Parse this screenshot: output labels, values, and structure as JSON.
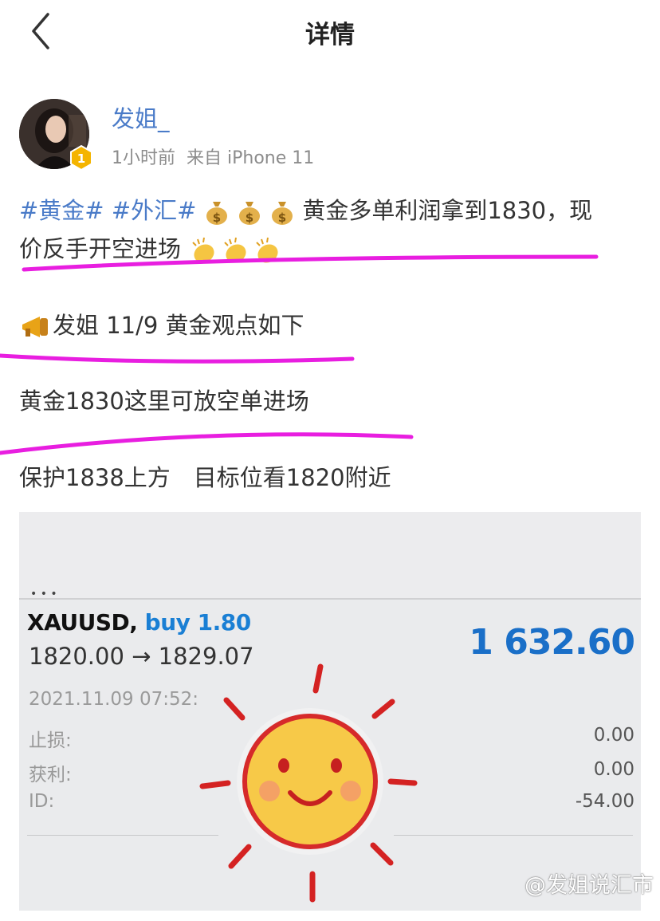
{
  "header": {
    "title": "详情",
    "back_icon": "chevron-left-icon"
  },
  "user": {
    "name": "发姐_",
    "time": "1小时前",
    "source": "来自 iPhone 11",
    "badge_level": "1"
  },
  "post": {
    "tags": [
      "#黄金#",
      "#外汇#"
    ],
    "line1_text": "黄金多单利润拿到1830，现",
    "line2_text": "价反手开空进场",
    "line3_text": "发姐 11/9 黄金观点如下",
    "line4_text": "黄金1830这里可放空单进场",
    "line5_text": "保护1838上方　目标位看1820附近"
  },
  "trade": {
    "symbol": "XAUUSD,",
    "side": "buy 1.80",
    "prices": "1820.00 → 1829.07",
    "profit": "1 632.60",
    "timestamp": "2021.11.09 07:52:",
    "rows": [
      {
        "label": "止损:",
        "value": "0.00"
      },
      {
        "label": "获利:",
        "value": "0.00"
      },
      {
        "label": "ID:",
        "value": "-54.00"
      }
    ]
  },
  "watermark": "@发姐说汇市",
  "colors": {
    "link": "#4a7bc8",
    "marker": "#e81ee0",
    "profit": "#1a6fc8",
    "buy": "#1a7fd4"
  }
}
